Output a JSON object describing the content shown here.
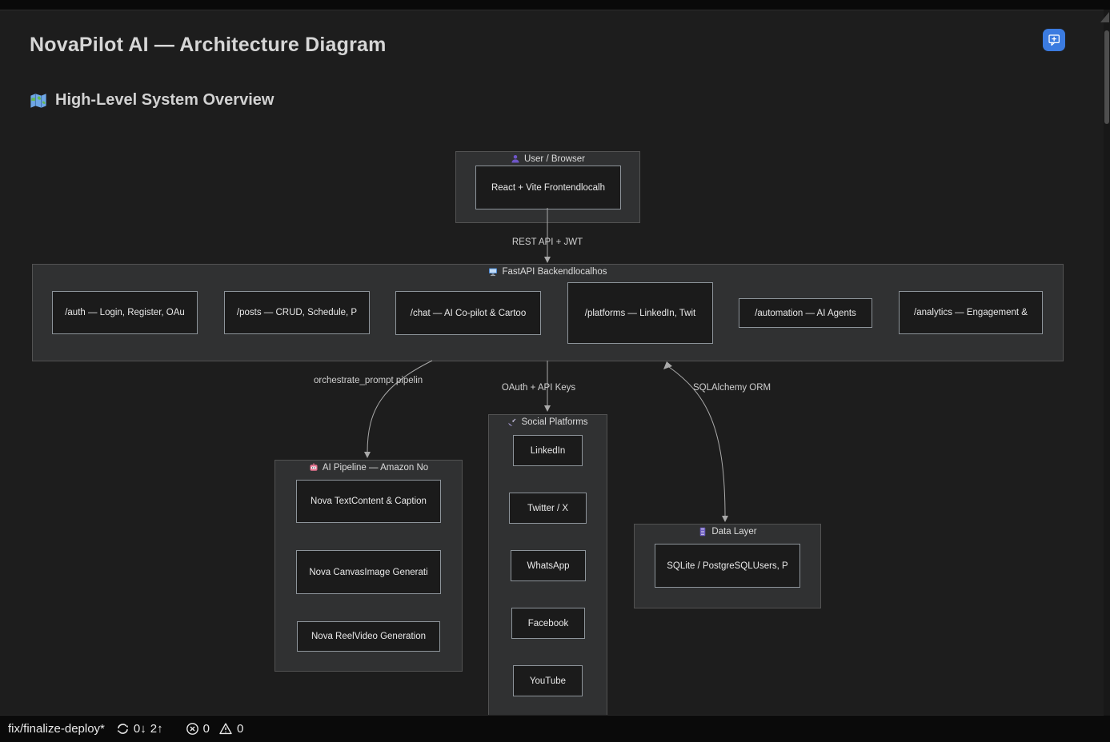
{
  "window": {
    "title": "NovaPilot AI — Architecture Diagram",
    "heading": "High-Level System Overview",
    "heading_icon": "world-map-icon"
  },
  "toolbar": {
    "add_comment_icon": "comment-add-icon"
  },
  "colors": {
    "accent_button": "#3b7be0",
    "cluster_fill": "#303132",
    "node_fill": "#1b1b1b",
    "node_border": "#8d949a",
    "page_bg": "#1d1d1d"
  },
  "diagram": {
    "clusters": {
      "user": {
        "icon": "person-icon",
        "label": "User / Browser",
        "node": "React + Vite Frontendlocalh"
      },
      "fastapi": {
        "icon": "monitor-icon",
        "label": "FastAPI Backendlocalhos",
        "nodes": [
          "/auth — Login, Register, OAu",
          "/posts — CRUD, Schedule, P",
          "/chat — AI Co-pilot & Cartoo",
          "/platforms — LinkedIn, Twit",
          "/automation — AI Agents",
          "/analytics — Engagement &"
        ]
      },
      "ai_pipeline": {
        "icon": "robot-icon",
        "label": "AI Pipeline — Amazon No",
        "nodes": [
          "Nova TextContent & Caption",
          "Nova CanvasImage Generati",
          "Nova ReelVideo Generation"
        ]
      },
      "social": {
        "icon": "satellite-icon",
        "label": "Social Platforms",
        "nodes": [
          "LinkedIn",
          "Twitter / X",
          "WhatsApp",
          "Facebook",
          "YouTube"
        ]
      },
      "data_layer": {
        "icon": "file-cabinet-icon",
        "label": "Data Layer",
        "node": "SQLite / PostgreSQLUsers, P"
      }
    },
    "edges": {
      "rest": "REST API + JWT",
      "orchestrate": "orchestrate_prompt pipelin",
      "oauth": "OAuth + API Keys",
      "orm": "SQLAlchemy ORM"
    }
  },
  "statusbar": {
    "branch": "fix/finalize-deploy*",
    "sync_icon": "sync-icon",
    "sync_behind": "0↓",
    "sync_ahead": "2↑",
    "error_icon": "error-circle-icon",
    "errors": "0",
    "warning_icon": "warning-triangle-icon",
    "warnings": "0"
  }
}
